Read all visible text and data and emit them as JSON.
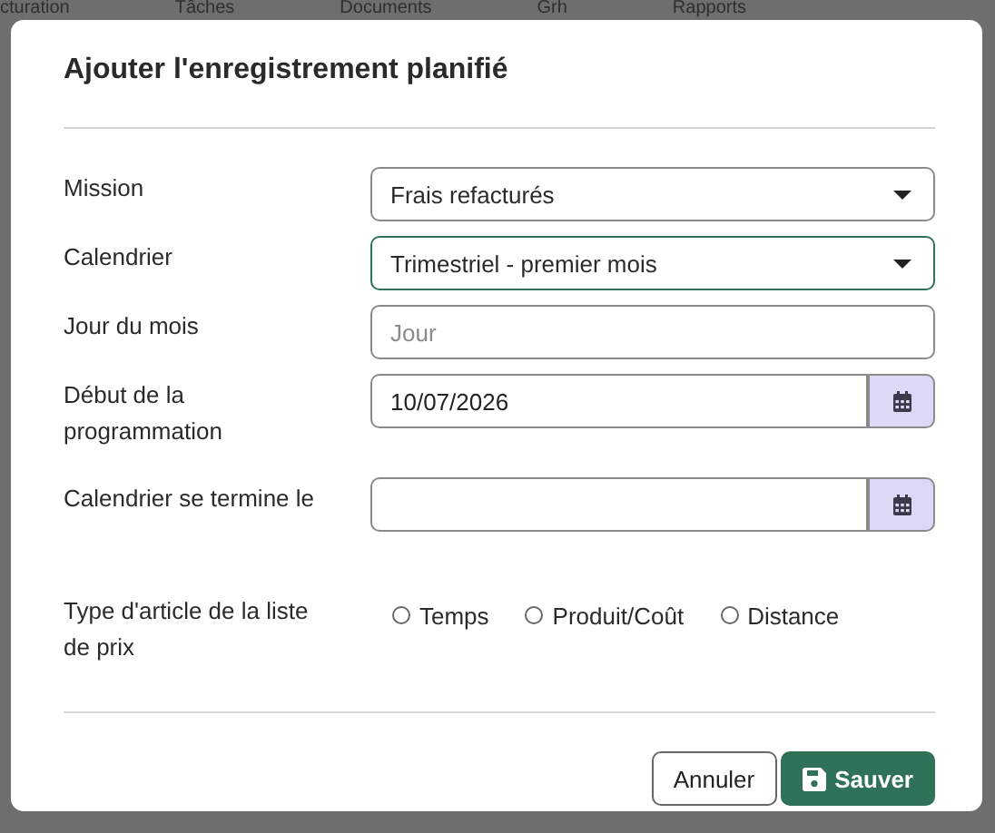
{
  "nav": [
    "cturation",
    "Tâches",
    "Documents",
    "Grh",
    "Rapports"
  ],
  "dialog": {
    "title": "Ajouter l'enregistrement planifié",
    "fields": [
      {
        "kind": "select",
        "label": "Mission",
        "value": "Frais refacturés",
        "focused": false
      },
      {
        "kind": "select",
        "label": "Calendrier",
        "value": "Trimestriel - premier mois",
        "focused": true
      },
      {
        "kind": "text",
        "label": "Jour du mois",
        "placeholder": "Jour"
      },
      {
        "kind": "date",
        "label": "Début de la programmation",
        "value": "10/07/2026"
      },
      {
        "kind": "date",
        "label": "Calendrier se termine le"
      },
      {
        "kind": "radio",
        "label": "Type d'article de la liste de prix",
        "options": [
          {
            "label": "Temps",
            "selected": false
          },
          {
            "label": "Produit/Coût",
            "selected": false
          },
          {
            "label": "Distance",
            "selected": false
          }
        ]
      }
    ],
    "buttons": [
      {
        "kind": "secondary",
        "label": "Annuler"
      },
      {
        "kind": "primary",
        "label": "Sauver"
      }
    ]
  }
}
